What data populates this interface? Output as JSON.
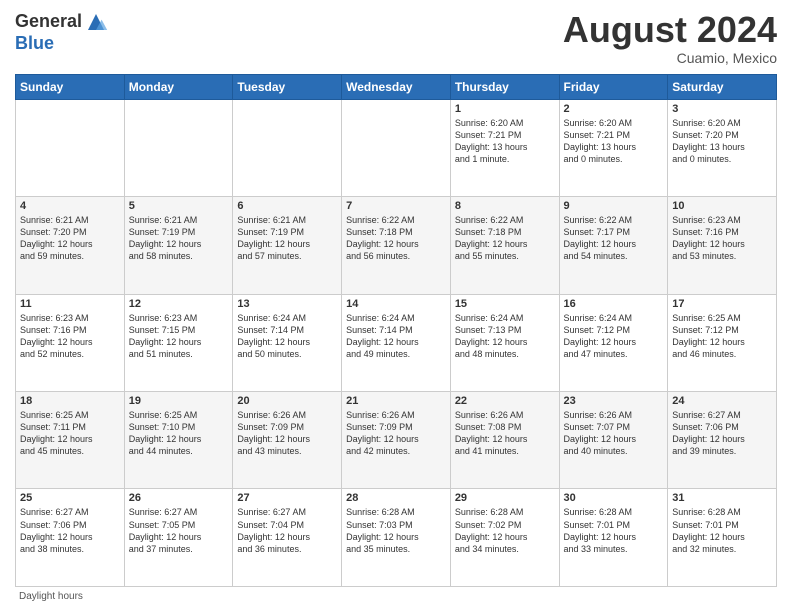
{
  "header": {
    "logo_general": "General",
    "logo_blue": "Blue",
    "month_year": "August 2024",
    "location": "Cuamio, Mexico"
  },
  "footer": {
    "note": "Daylight hours"
  },
  "days_of_week": [
    "Sunday",
    "Monday",
    "Tuesday",
    "Wednesday",
    "Thursday",
    "Friday",
    "Saturday"
  ],
  "weeks": [
    [
      {
        "day": "",
        "info": ""
      },
      {
        "day": "",
        "info": ""
      },
      {
        "day": "",
        "info": ""
      },
      {
        "day": "",
        "info": ""
      },
      {
        "day": "1",
        "info": "Sunrise: 6:20 AM\nSunset: 7:21 PM\nDaylight: 13 hours\nand 1 minute."
      },
      {
        "day": "2",
        "info": "Sunrise: 6:20 AM\nSunset: 7:21 PM\nDaylight: 13 hours\nand 0 minutes."
      },
      {
        "day": "3",
        "info": "Sunrise: 6:20 AM\nSunset: 7:20 PM\nDaylight: 13 hours\nand 0 minutes."
      }
    ],
    [
      {
        "day": "4",
        "info": "Sunrise: 6:21 AM\nSunset: 7:20 PM\nDaylight: 12 hours\nand 59 minutes."
      },
      {
        "day": "5",
        "info": "Sunrise: 6:21 AM\nSunset: 7:19 PM\nDaylight: 12 hours\nand 58 minutes."
      },
      {
        "day": "6",
        "info": "Sunrise: 6:21 AM\nSunset: 7:19 PM\nDaylight: 12 hours\nand 57 minutes."
      },
      {
        "day": "7",
        "info": "Sunrise: 6:22 AM\nSunset: 7:18 PM\nDaylight: 12 hours\nand 56 minutes."
      },
      {
        "day": "8",
        "info": "Sunrise: 6:22 AM\nSunset: 7:18 PM\nDaylight: 12 hours\nand 55 minutes."
      },
      {
        "day": "9",
        "info": "Sunrise: 6:22 AM\nSunset: 7:17 PM\nDaylight: 12 hours\nand 54 minutes."
      },
      {
        "day": "10",
        "info": "Sunrise: 6:23 AM\nSunset: 7:16 PM\nDaylight: 12 hours\nand 53 minutes."
      }
    ],
    [
      {
        "day": "11",
        "info": "Sunrise: 6:23 AM\nSunset: 7:16 PM\nDaylight: 12 hours\nand 52 minutes."
      },
      {
        "day": "12",
        "info": "Sunrise: 6:23 AM\nSunset: 7:15 PM\nDaylight: 12 hours\nand 51 minutes."
      },
      {
        "day": "13",
        "info": "Sunrise: 6:24 AM\nSunset: 7:14 PM\nDaylight: 12 hours\nand 50 minutes."
      },
      {
        "day": "14",
        "info": "Sunrise: 6:24 AM\nSunset: 7:14 PM\nDaylight: 12 hours\nand 49 minutes."
      },
      {
        "day": "15",
        "info": "Sunrise: 6:24 AM\nSunset: 7:13 PM\nDaylight: 12 hours\nand 48 minutes."
      },
      {
        "day": "16",
        "info": "Sunrise: 6:24 AM\nSunset: 7:12 PM\nDaylight: 12 hours\nand 47 minutes."
      },
      {
        "day": "17",
        "info": "Sunrise: 6:25 AM\nSunset: 7:12 PM\nDaylight: 12 hours\nand 46 minutes."
      }
    ],
    [
      {
        "day": "18",
        "info": "Sunrise: 6:25 AM\nSunset: 7:11 PM\nDaylight: 12 hours\nand 45 minutes."
      },
      {
        "day": "19",
        "info": "Sunrise: 6:25 AM\nSunset: 7:10 PM\nDaylight: 12 hours\nand 44 minutes."
      },
      {
        "day": "20",
        "info": "Sunrise: 6:26 AM\nSunset: 7:09 PM\nDaylight: 12 hours\nand 43 minutes."
      },
      {
        "day": "21",
        "info": "Sunrise: 6:26 AM\nSunset: 7:09 PM\nDaylight: 12 hours\nand 42 minutes."
      },
      {
        "day": "22",
        "info": "Sunrise: 6:26 AM\nSunset: 7:08 PM\nDaylight: 12 hours\nand 41 minutes."
      },
      {
        "day": "23",
        "info": "Sunrise: 6:26 AM\nSunset: 7:07 PM\nDaylight: 12 hours\nand 40 minutes."
      },
      {
        "day": "24",
        "info": "Sunrise: 6:27 AM\nSunset: 7:06 PM\nDaylight: 12 hours\nand 39 minutes."
      }
    ],
    [
      {
        "day": "25",
        "info": "Sunrise: 6:27 AM\nSunset: 7:06 PM\nDaylight: 12 hours\nand 38 minutes."
      },
      {
        "day": "26",
        "info": "Sunrise: 6:27 AM\nSunset: 7:05 PM\nDaylight: 12 hours\nand 37 minutes."
      },
      {
        "day": "27",
        "info": "Sunrise: 6:27 AM\nSunset: 7:04 PM\nDaylight: 12 hours\nand 36 minutes."
      },
      {
        "day": "28",
        "info": "Sunrise: 6:28 AM\nSunset: 7:03 PM\nDaylight: 12 hours\nand 35 minutes."
      },
      {
        "day": "29",
        "info": "Sunrise: 6:28 AM\nSunset: 7:02 PM\nDaylight: 12 hours\nand 34 minutes."
      },
      {
        "day": "30",
        "info": "Sunrise: 6:28 AM\nSunset: 7:01 PM\nDaylight: 12 hours\nand 33 minutes."
      },
      {
        "day": "31",
        "info": "Sunrise: 6:28 AM\nSunset: 7:01 PM\nDaylight: 12 hours\nand 32 minutes."
      }
    ]
  ]
}
